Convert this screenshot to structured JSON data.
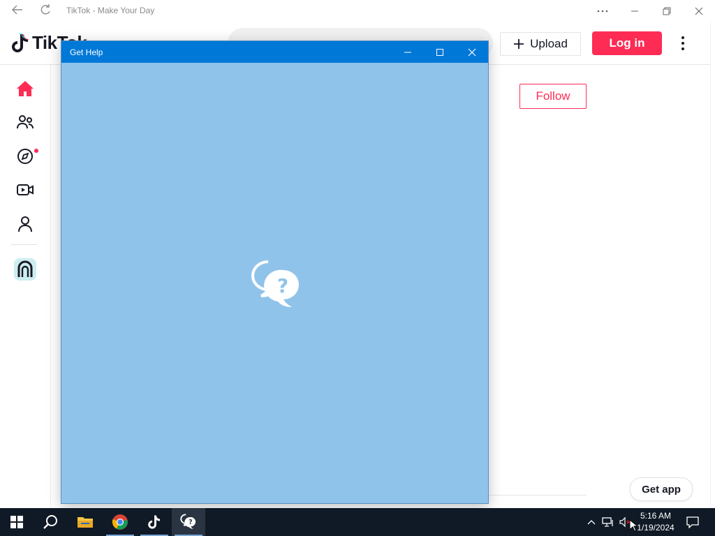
{
  "window": {
    "title": "TikTok - Make Your Day",
    "back_icon": "back-arrow-icon",
    "refresh_icon": "refresh-icon"
  },
  "header": {
    "logo_text": "TikTok",
    "upload_label": "Upload",
    "login_label": "Log in",
    "brand_color": "#fe2c55"
  },
  "sidebar": {
    "items": [
      {
        "name": "home",
        "icon": "home-icon"
      },
      {
        "name": "following",
        "icon": "people-icon"
      },
      {
        "name": "explore",
        "icon": "compass-icon"
      },
      {
        "name": "live",
        "icon": "live-video-icon"
      },
      {
        "name": "profile",
        "icon": "person-icon"
      },
      {
        "name": "app-badge",
        "icon": "tiktok-app-badge-icon"
      }
    ]
  },
  "main": {
    "follow_label": "Follow",
    "get_app_label": "Get app"
  },
  "help_window": {
    "title": "Get Help",
    "background": "#90c3ea",
    "title_color": "#0078d7",
    "splash_icon": "help-chat-bubbles-icon"
  },
  "taskbar": {
    "apps": [
      "start",
      "search",
      "file-explorer",
      "chrome",
      "tiktok",
      "get-help"
    ],
    "active_app": "get-help",
    "time": "5:16 AM",
    "date": "1/19/2024"
  }
}
